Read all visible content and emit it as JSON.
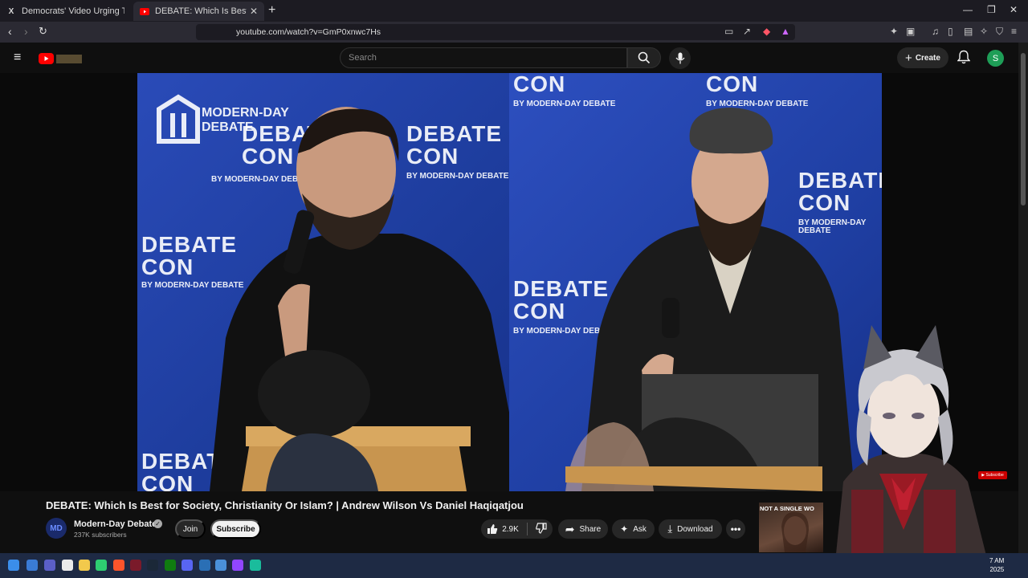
{
  "browser": {
    "tabs": [
      {
        "title": "Democrats' Video Urging Troops to Re",
        "icon": "x-logo-icon",
        "active": false
      },
      {
        "title": "DEBATE: Which Is Best for Society, Ch",
        "icon": "youtube-icon",
        "active": true
      }
    ],
    "url": "youtube.com/watch?v=GmP0xnwc7Hs"
  },
  "youtube": {
    "search_placeholder": "Search",
    "create_label": "Create",
    "account_initial": "S"
  },
  "video": {
    "branding": {
      "logo_line1": "MODERN-DAY",
      "logo_line2": "DEBATE",
      "big1": "DEBATE",
      "big2": "CON",
      "small": "BY MODERN-DAY DEBATE"
    },
    "title": "DEBATE: Which Is Best for Society, Christianity Or Islam? | Andrew Wilson Vs Daniel Haqiqatjou"
  },
  "channel": {
    "name": "Modern-Day Debate",
    "subscribers": "237K subscribers",
    "join_label": "Join",
    "subscribe_label": "Subscribe"
  },
  "actions": {
    "likes": "2.9K",
    "share_label": "Share",
    "ask_label": "Ask",
    "download_label": "Download"
  },
  "sidebar": {
    "ad_text": "NOT A SINGLE WO"
  },
  "taskbar": {
    "time": "7 AM",
    "year": "2025"
  },
  "colors": {
    "youtube_red": "#ff0000",
    "backdrop_blue": "#2140a8",
    "avatar_green": "#1e9e57"
  }
}
